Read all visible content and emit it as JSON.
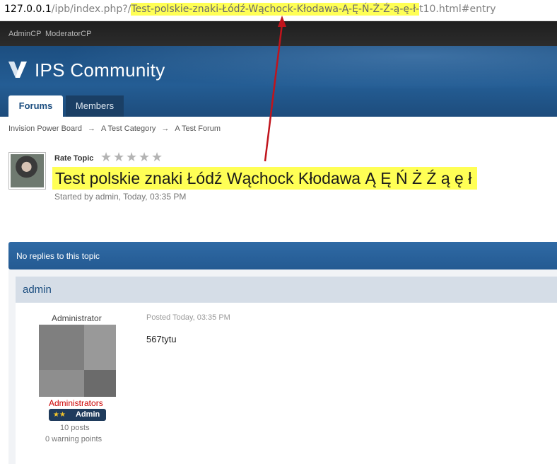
{
  "browser": {
    "url_host": "127.0.0.1",
    "url_path": "/ipb/index.php?/",
    "url_highlight": "Test-polskie-znaki-Łódź-Wąchock-Kłodawa-Ą-Ę-Ń-Ż-Ź-ą-ę-ł-",
    "url_tail": "t10.html#entry"
  },
  "adminbar": {
    "admincp": "AdminCP",
    "moderatorcp": "ModeratorCP"
  },
  "header": {
    "logo_text": "IPS Community",
    "tabs": [
      {
        "label": "Forums",
        "active": true
      },
      {
        "label": "Members",
        "active": false
      }
    ]
  },
  "breadcrumb": {
    "items": [
      "Invision Power Board",
      "A Test Category",
      "A Test Forum"
    ],
    "separator": "→"
  },
  "topic": {
    "rate_label": "Rate Topic",
    "rating": {
      "value": 0,
      "max": 5
    },
    "title": "Test polskie znaki Łódź Wąchock Kłodawa Ą Ę Ń Ż Ź ą ę ł",
    "started_by": "Started by admin, Today, 03:35 PM"
  },
  "replies": {
    "status": "No replies to this topic"
  },
  "post": {
    "author": "admin",
    "author_title": "Administrator",
    "group": "Administrators",
    "badge_stars": "★★",
    "badge_label": "Admin",
    "post_count": "10 posts",
    "warning_points": "0 warning points",
    "posted": "Posted Today, 03:35 PM",
    "content": "567tytu"
  },
  "colors": {
    "highlight": "#ffff55",
    "header_blue": "#245d94",
    "arrow": "#c0141c",
    "group_red": "#cc0000"
  },
  "icons": {
    "logo": "ips-logo-icon",
    "star": "star-icon"
  }
}
